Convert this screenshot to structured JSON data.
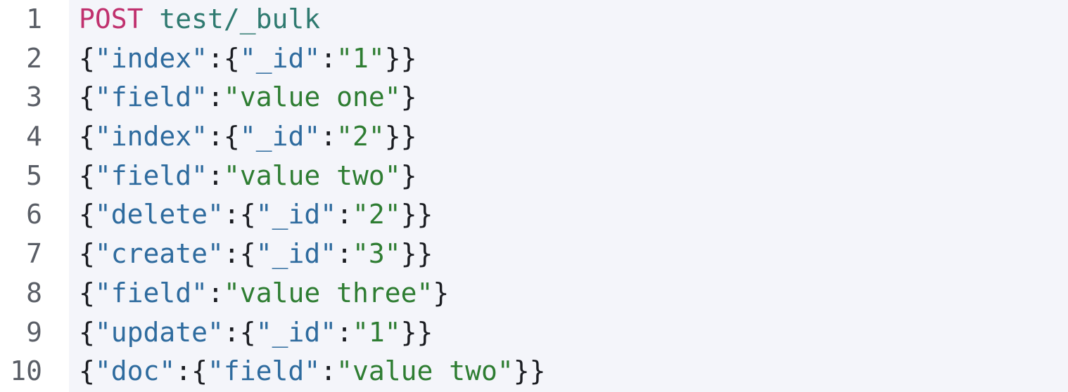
{
  "colors": {
    "method": "#c0316e",
    "path": "#2f7a70",
    "punct": "#1b1d22",
    "key": "#2e6b9e",
    "string": "#2e7d32",
    "line_number": "#5a5e66",
    "code_background": "#f4f5fa"
  },
  "lines": [
    {
      "num": "1",
      "tokens": [
        {
          "t": "method",
          "v": "POST"
        },
        {
          "t": "punct",
          "v": " "
        },
        {
          "t": "path",
          "v": "test/_bulk"
        }
      ]
    },
    {
      "num": "2",
      "tokens": [
        {
          "t": "punct",
          "v": "{"
        },
        {
          "t": "key",
          "v": "\"index\""
        },
        {
          "t": "punct",
          "v": ":{"
        },
        {
          "t": "key",
          "v": "\"_id\""
        },
        {
          "t": "punct",
          "v": ":"
        },
        {
          "t": "str",
          "v": "\"1\""
        },
        {
          "t": "punct",
          "v": "}}"
        }
      ]
    },
    {
      "num": "3",
      "tokens": [
        {
          "t": "punct",
          "v": "{"
        },
        {
          "t": "key",
          "v": "\"field\""
        },
        {
          "t": "punct",
          "v": ":"
        },
        {
          "t": "str",
          "v": "\"value one\""
        },
        {
          "t": "punct",
          "v": "}"
        }
      ]
    },
    {
      "num": "4",
      "tokens": [
        {
          "t": "punct",
          "v": "{"
        },
        {
          "t": "key",
          "v": "\"index\""
        },
        {
          "t": "punct",
          "v": ":{"
        },
        {
          "t": "key",
          "v": "\"_id\""
        },
        {
          "t": "punct",
          "v": ":"
        },
        {
          "t": "str",
          "v": "\"2\""
        },
        {
          "t": "punct",
          "v": "}}"
        }
      ]
    },
    {
      "num": "5",
      "tokens": [
        {
          "t": "punct",
          "v": "{"
        },
        {
          "t": "key",
          "v": "\"field\""
        },
        {
          "t": "punct",
          "v": ":"
        },
        {
          "t": "str",
          "v": "\"value two\""
        },
        {
          "t": "punct",
          "v": "}"
        }
      ]
    },
    {
      "num": "6",
      "tokens": [
        {
          "t": "punct",
          "v": "{"
        },
        {
          "t": "key",
          "v": "\"delete\""
        },
        {
          "t": "punct",
          "v": ":{"
        },
        {
          "t": "key",
          "v": "\"_id\""
        },
        {
          "t": "punct",
          "v": ":"
        },
        {
          "t": "str",
          "v": "\"2\""
        },
        {
          "t": "punct",
          "v": "}}"
        }
      ]
    },
    {
      "num": "7",
      "tokens": [
        {
          "t": "punct",
          "v": "{"
        },
        {
          "t": "key",
          "v": "\"create\""
        },
        {
          "t": "punct",
          "v": ":{"
        },
        {
          "t": "key",
          "v": "\"_id\""
        },
        {
          "t": "punct",
          "v": ":"
        },
        {
          "t": "str",
          "v": "\"3\""
        },
        {
          "t": "punct",
          "v": "}}"
        }
      ]
    },
    {
      "num": "8",
      "tokens": [
        {
          "t": "punct",
          "v": "{"
        },
        {
          "t": "key",
          "v": "\"field\""
        },
        {
          "t": "punct",
          "v": ":"
        },
        {
          "t": "str",
          "v": "\"value three\""
        },
        {
          "t": "punct",
          "v": "}"
        }
      ]
    },
    {
      "num": "9",
      "tokens": [
        {
          "t": "punct",
          "v": "{"
        },
        {
          "t": "key",
          "v": "\"update\""
        },
        {
          "t": "punct",
          "v": ":{"
        },
        {
          "t": "key",
          "v": "\"_id\""
        },
        {
          "t": "punct",
          "v": ":"
        },
        {
          "t": "str",
          "v": "\"1\""
        },
        {
          "t": "punct",
          "v": "}}"
        }
      ]
    },
    {
      "num": "10",
      "tokens": [
        {
          "t": "punct",
          "v": "{"
        },
        {
          "t": "key",
          "v": "\"doc\""
        },
        {
          "t": "punct",
          "v": ":{"
        },
        {
          "t": "key",
          "v": "\"field\""
        },
        {
          "t": "punct",
          "v": ":"
        },
        {
          "t": "str",
          "v": "\"value two\""
        },
        {
          "t": "punct",
          "v": "}}"
        }
      ]
    }
  ]
}
